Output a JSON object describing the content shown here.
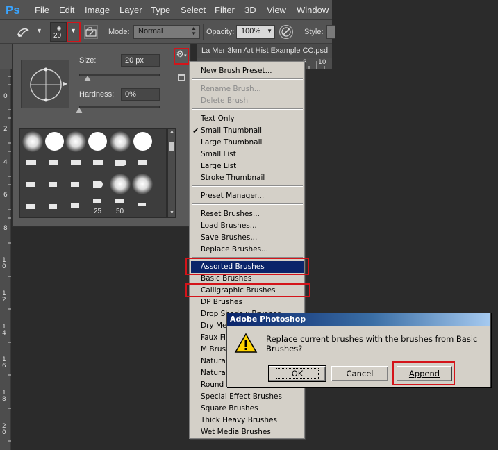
{
  "app": {
    "logo": "Ps"
  },
  "menubar": {
    "items": [
      "File",
      "Edit",
      "Image",
      "Layer",
      "Type",
      "Select",
      "Filter",
      "3D",
      "View",
      "Window"
    ]
  },
  "options_bar": {
    "brush_size": "20",
    "mode_label": "Mode:",
    "mode_value": "Normal",
    "opacity_label": "Opacity:",
    "opacity_value": "100%",
    "style_label": "Style:"
  },
  "document": {
    "tab_title": "La Mer 3km Art Hist Example CC.psd",
    "ruler_top_numbers": [
      "8",
      "10"
    ],
    "ruler_left_numbers": [
      "0",
      "2",
      "4",
      "6",
      "8",
      "10",
      "12",
      "14",
      "16",
      "18",
      "20"
    ]
  },
  "brush_panel": {
    "size_label": "Size:",
    "size_value": "20 px",
    "size_slider": 0.1,
    "hardness_label": "Hardness:",
    "hardness_value": "0%",
    "hardness_slider": 0.0,
    "brush_numbers": [
      "25",
      "50"
    ]
  },
  "context_menu": {
    "new_preset": "New Brush Preset...",
    "rename": "Rename Brush...",
    "delete": "Delete Brush",
    "text_only": "Text Only",
    "small_thumb": "Small Thumbnail",
    "large_thumb": "Large Thumbnail",
    "small_list": "Small List",
    "large_list": "Large List",
    "stroke_thumb": "Stroke Thumbnail",
    "preset_manager": "Preset Manager...",
    "reset": "Reset Brushes...",
    "load": "Load Brushes...",
    "save": "Save Brushes...",
    "replace": "Replace Brushes...",
    "library_items": [
      "Assorted Brushes",
      "Basic Brushes",
      "Calligraphic Brushes",
      "DP Brushes",
      "Drop Shadow Brushes",
      "Dry Media Brushes",
      "Faux Finish Brushes",
      "M Brushes",
      "Natural Brushes 2",
      "Natural Brushes",
      "Round Brushes with Size",
      "Special Effect Brushes",
      "Square Brushes",
      "Thick Heavy Brushes",
      "Wet Media Brushes"
    ],
    "checked_item": "Small Thumbnail",
    "highlighted_item": "Assorted Brushes"
  },
  "dialog": {
    "title": "Adobe Photoshop",
    "message": "Replace current brushes with the brushes from Basic Brushes?",
    "ok_label": "OK",
    "cancel_label": "Cancel",
    "append_label": "Append"
  },
  "colors": {
    "highlight_red": "#d4141a",
    "menu_highlight": "#0a246a",
    "ps_blue": "#39a4ff"
  }
}
